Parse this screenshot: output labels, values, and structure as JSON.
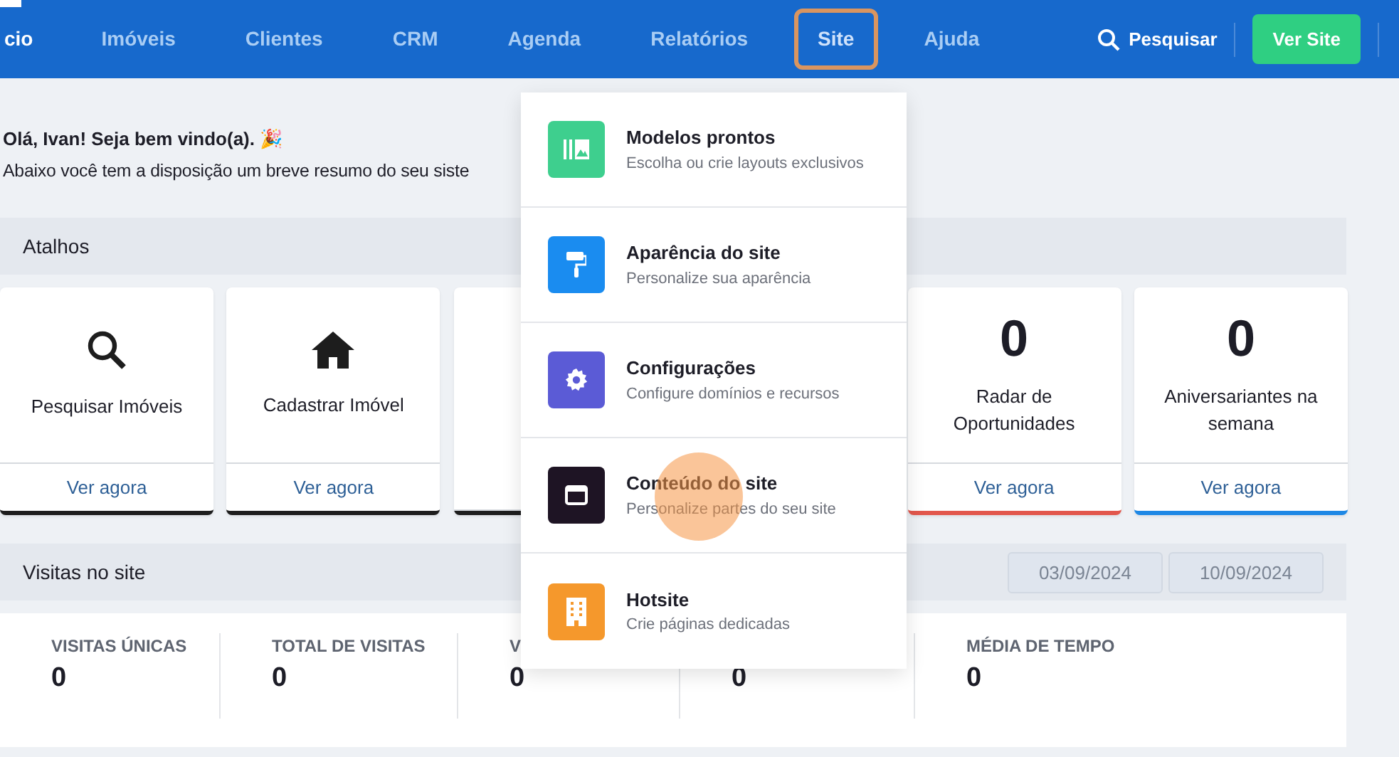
{
  "nav": {
    "items": [
      {
        "label": "cio",
        "selected": false
      },
      {
        "label": "Imóveis",
        "selected": false
      },
      {
        "label": "Clientes",
        "selected": false
      },
      {
        "label": "CRM",
        "selected": false
      },
      {
        "label": "Agenda",
        "selected": false
      },
      {
        "label": "Relatórios",
        "selected": false
      },
      {
        "label": "Site",
        "selected": true
      },
      {
        "label": "Ajuda",
        "selected": false
      }
    ],
    "search_label": "Pesquisar",
    "cta": "Ver Site"
  },
  "greeting": "Olá, Ivan! Seja bem vindo(a). 🎉",
  "intro": "Abaixo você tem a disposição um breve resumo do seu siste",
  "shortcuts": {
    "title": "Atalhos",
    "cards": [
      {
        "kind": "search",
        "label": "Pesquisar Imóveis",
        "link": "Ver agora",
        "color": "#1e1e1e"
      },
      {
        "kind": "home",
        "label": "Cadastrar Imóvel",
        "link": "Ver agora",
        "color": "#1e1e1e"
      },
      {
        "kind": "covered",
        "color": "#1e1e1e"
      },
      {
        "kind": "count",
        "value": "0",
        "label": "Radar de Oportunidades",
        "link": "Ver agora",
        "color": "#e2574c"
      },
      {
        "kind": "count",
        "value": "0",
        "label": "Aniversariantes na semana",
        "link": "Ver agora",
        "color": "#1e88e5"
      }
    ]
  },
  "visits": {
    "title": "Visitas no site",
    "date_from": "03/09/2024",
    "date_to": "10/09/2024",
    "stats": [
      {
        "label": "VISITAS ÚNICAS",
        "value": "0"
      },
      {
        "label": "TOTAL DE VISITAS",
        "value": "0"
      },
      {
        "label": "V",
        "value": "0"
      },
      {
        "value": "0"
      },
      {
        "label": "MÉDIA DE TEMPO",
        "value": "0"
      }
    ]
  },
  "dropdown": {
    "items": [
      {
        "kind": "templates",
        "title": "Modelos prontos",
        "subtitle": "Escolha ou crie layouts exclusivos",
        "color": "#3ecf8e",
        "clicked": false
      },
      {
        "kind": "roller",
        "title": "Aparência do site",
        "subtitle": "Personalize sua aparência",
        "color": "#1a8cf0",
        "clicked": false
      },
      {
        "kind": "gear",
        "title": "Configurações",
        "subtitle": "Configure domínios e recursos",
        "color": "#5b5bd6",
        "clicked": false
      },
      {
        "kind": "window",
        "title": "Conteúdo do site",
        "subtitle": "Personalize partes do seu site",
        "color": "#1e1424",
        "clicked": true
      },
      {
        "kind": "building",
        "title": "Hotsite",
        "subtitle": "Crie páginas dedicadas",
        "color": "#f5982c",
        "clicked": false
      }
    ]
  }
}
